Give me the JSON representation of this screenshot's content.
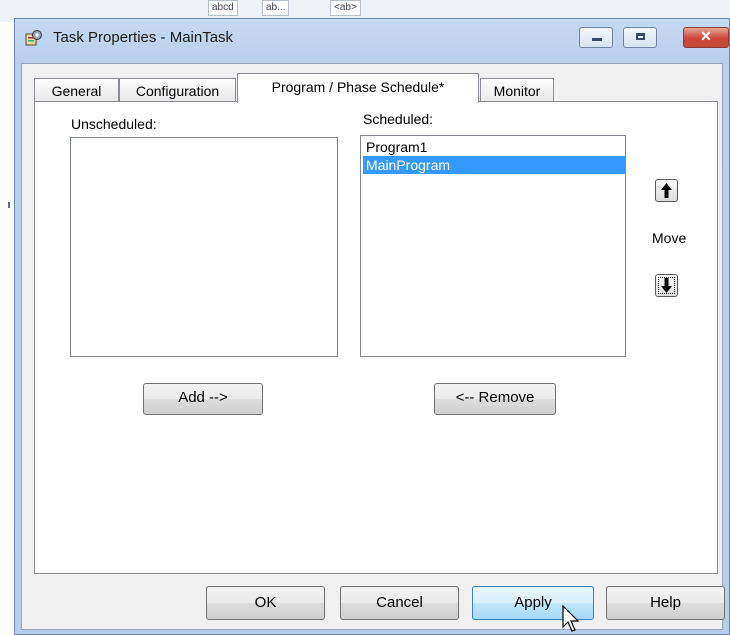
{
  "background": {
    "toolbar_items": [
      "abcd",
      "ab...",
      "<ab>"
    ]
  },
  "window": {
    "title": "Task Properties - MainTask",
    "icon": "task-properties-icon",
    "controls": {
      "minimize": "minimize-icon",
      "maximize": "maximize-icon",
      "close_glyph": "✕"
    }
  },
  "tabs": [
    {
      "label": "General",
      "active": false
    },
    {
      "label": "Configuration",
      "active": false
    },
    {
      "label": "Program / Phase Schedule*",
      "active": true
    },
    {
      "label": "Monitor",
      "active": false
    }
  ],
  "schedule": {
    "unscheduled_label": "Unscheduled:",
    "unscheduled_items": [],
    "scheduled_label": "Scheduled:",
    "scheduled_items": [
      {
        "label": "Program1",
        "selected": false
      },
      {
        "label": "MainProgram",
        "selected": true
      }
    ],
    "add_button": "Add -->",
    "remove_button": "<-- Remove",
    "move_label": "Move",
    "move_up_icon": "arrow-up-icon",
    "move_down_icon": "arrow-down-icon"
  },
  "footer": {
    "ok": "OK",
    "cancel": "Cancel",
    "apply": "Apply",
    "help": "Help"
  },
  "colors": {
    "selection": "#3399ff",
    "close_button": "#c9473a",
    "titlebar": "#c7daf2"
  }
}
